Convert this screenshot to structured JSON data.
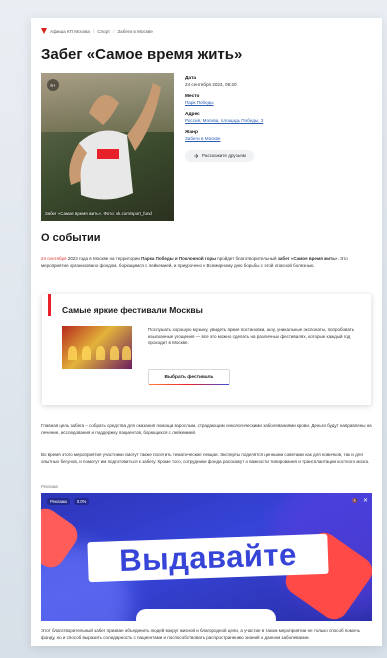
{
  "breadcrumbs": {
    "site": "Афиша КП Москва",
    "category": "Спорт",
    "current": "Забеги в Москве",
    "separator": "/"
  },
  "event": {
    "title": "Забег «Самое время жить»",
    "photo_caption": "Забег «Самое время жить». Фото: vk.com/sport_fund",
    "age_badge": "6+",
    "date_label": "Дата",
    "date_value": "24 сентября 2023, 08:20",
    "place_label": "Место",
    "place_value": "Парк Победы",
    "address_label": "Адрес",
    "address_value": "Россия, Москва, площадь Победы, 3",
    "genre_label": "Жанр",
    "genre_value": "Забеги в Москве",
    "share_label": "Расскажите друзьям"
  },
  "about": {
    "heading": "О событии",
    "p1": {
      "date": "24 сентября",
      "a": " 2023 года в Москве на территории ",
      "place": "Парка Победы и Поклонной горы",
      "b": " пройдет благотворительный ",
      "event": "забег «Самое время жить»",
      "c": ". Это мероприятие организовано фондом, борющимся с лейкемией, и приурочено к Всемирному дню борьбы с этой опасной болезнью."
    },
    "p2": "Главная цель забега – собрать средства для оказания помощи взрослым, страдающим онкологическими заболеваниями крови. Деньги будут направлены на лечение, исследования и поддержку пациентов, борющихся с лейкемией.",
    "p3": "Во время этого мероприятия участники смогут также посетить тематические лекции. Эксперты поделятся ценными советами как для новичков, так и для опытных бегунов, и помогут им подготовиться к забегу. Кроме того, сотрудники фонда расскажут о важности типирования и трансплантации костного мозга.",
    "p4": "Этот благотворительный забег призван объединить людей вокруг жизной и благородной цели, а участие в таком мероприятии не только способ помочь фонду, но и способ выразить солидарность с пациентами и поспособствовать распространению знаний о данном заболевании."
  },
  "festivals": {
    "title": "Самые яркие фестивали Москвы",
    "text": "Послушать хорошую музыку, увидеть яркие постановки, шоу, уникальные экспонаты, попробовать изысканные угощения — все это можно сделать на различных фестивалях, которые каждый год проходит в Москве.",
    "button": "Выбрать фестиваль",
    "accent": "#e8202a"
  },
  "ad": {
    "label": "Реклама",
    "tag": "Реклама",
    "info": "0.0%",
    "mute": "🔇",
    "close": "✕",
    "headline": "Выдавайте",
    "bg_color": "#3644d8"
  }
}
